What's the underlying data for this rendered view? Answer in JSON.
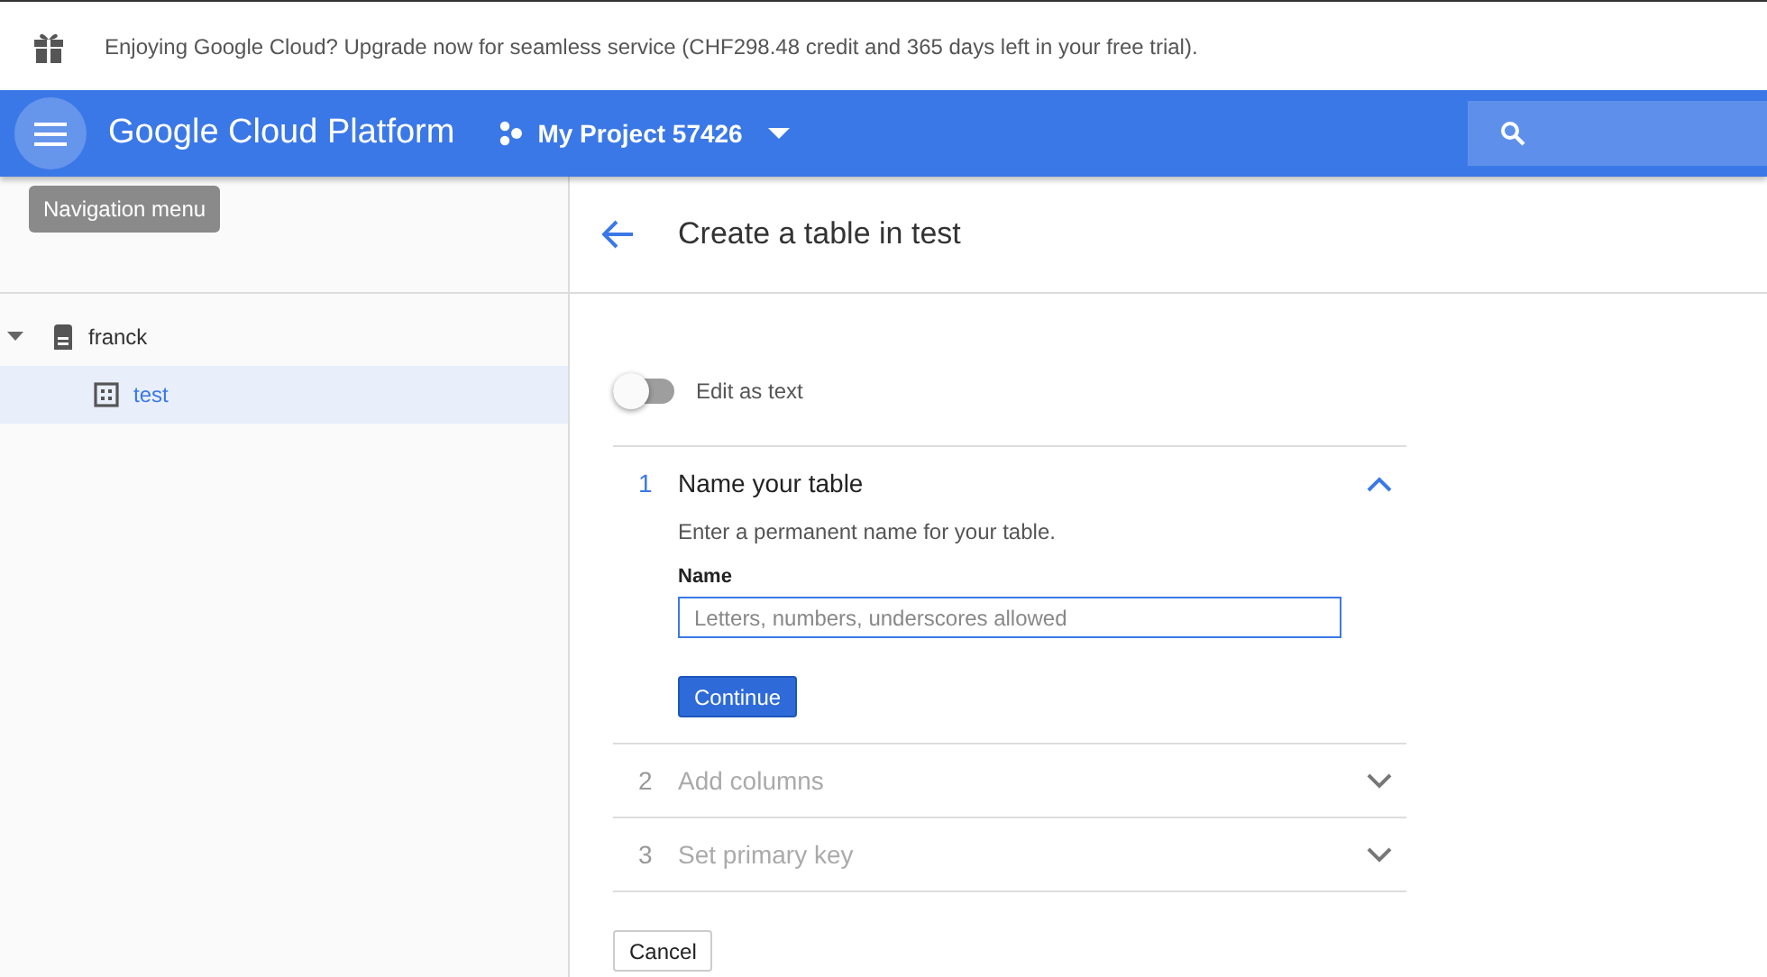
{
  "banner": {
    "text": "Enjoying Google Cloud? Upgrade now for seamless service (CHF298.48 credit and 365 days left in your free trial)."
  },
  "topbar": {
    "brand": "Google Cloud Platform",
    "project": "My Project 57426"
  },
  "tooltip": "Navigation menu",
  "tree": [
    {
      "label": "franck",
      "kind": "instance",
      "expanded": true,
      "selected": false,
      "children": [
        {
          "label": "test",
          "kind": "database",
          "selected": true
        }
      ]
    }
  ],
  "page": {
    "title": "Create a table in test"
  },
  "edit_as_text": {
    "label": "Edit as text",
    "on": false
  },
  "steps": [
    {
      "number": "1",
      "title": "Name your table",
      "expanded": true,
      "description": "Enter a permanent name for your table.",
      "field_label": "Name",
      "placeholder": "Letters, numbers, underscores allowed",
      "button": "Continue"
    },
    {
      "number": "2",
      "title": "Add columns",
      "expanded": false
    },
    {
      "number": "3",
      "title": "Set primary key",
      "expanded": false
    }
  ],
  "cancel": "Cancel"
}
